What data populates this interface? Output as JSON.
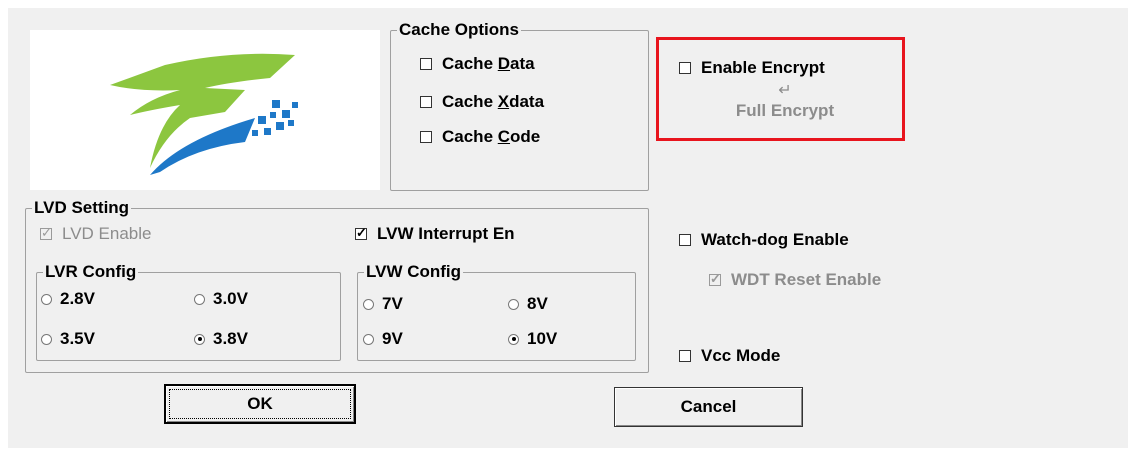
{
  "cache_options": {
    "title": "Cache Options",
    "items": [
      {
        "before": "Cache ",
        "underline": "D",
        "after": "ata",
        "checked": false
      },
      {
        "before": "Cache ",
        "underline": "X",
        "after": "data",
        "checked": false
      },
      {
        "before": "Cache ",
        "underline": "C",
        "after": "ode",
        "checked": false
      }
    ]
  },
  "encrypt": {
    "enable_label": "Enable Encrypt",
    "enable_checked": false,
    "return_glyph": "↵",
    "full_encrypt_label": "Full Encrypt",
    "highlight_color": "#e8141d"
  },
  "lvd_setting": {
    "title": "LVD Setting",
    "lvd_enable_label": "LVD Enable",
    "lvd_enable_checked": true,
    "lvw_interrupt_label": "LVW Interrupt En",
    "lvw_interrupt_checked": true,
    "lvr_config": {
      "title": "LVR Config",
      "options": [
        "2.8V",
        "3.0V",
        "3.5V",
        "3.8V"
      ],
      "selected": "3.8V"
    },
    "lvw_config": {
      "title": "LVW Config",
      "options": [
        "7V",
        "8V",
        "9V",
        "10V"
      ],
      "selected": "10V"
    }
  },
  "watchdog": {
    "enable_label": "Watch-dog Enable",
    "enable_checked": false,
    "wdt_reset_label": "WDT Reset Enable",
    "wdt_reset_checked": true
  },
  "vcc_mode": {
    "label": "Vcc Mode",
    "checked": false
  },
  "buttons": {
    "ok": "OK",
    "cancel": "Cancel"
  },
  "colors": {
    "logo_green": "#8cc63f",
    "logo_blue": "#1e78c8"
  }
}
